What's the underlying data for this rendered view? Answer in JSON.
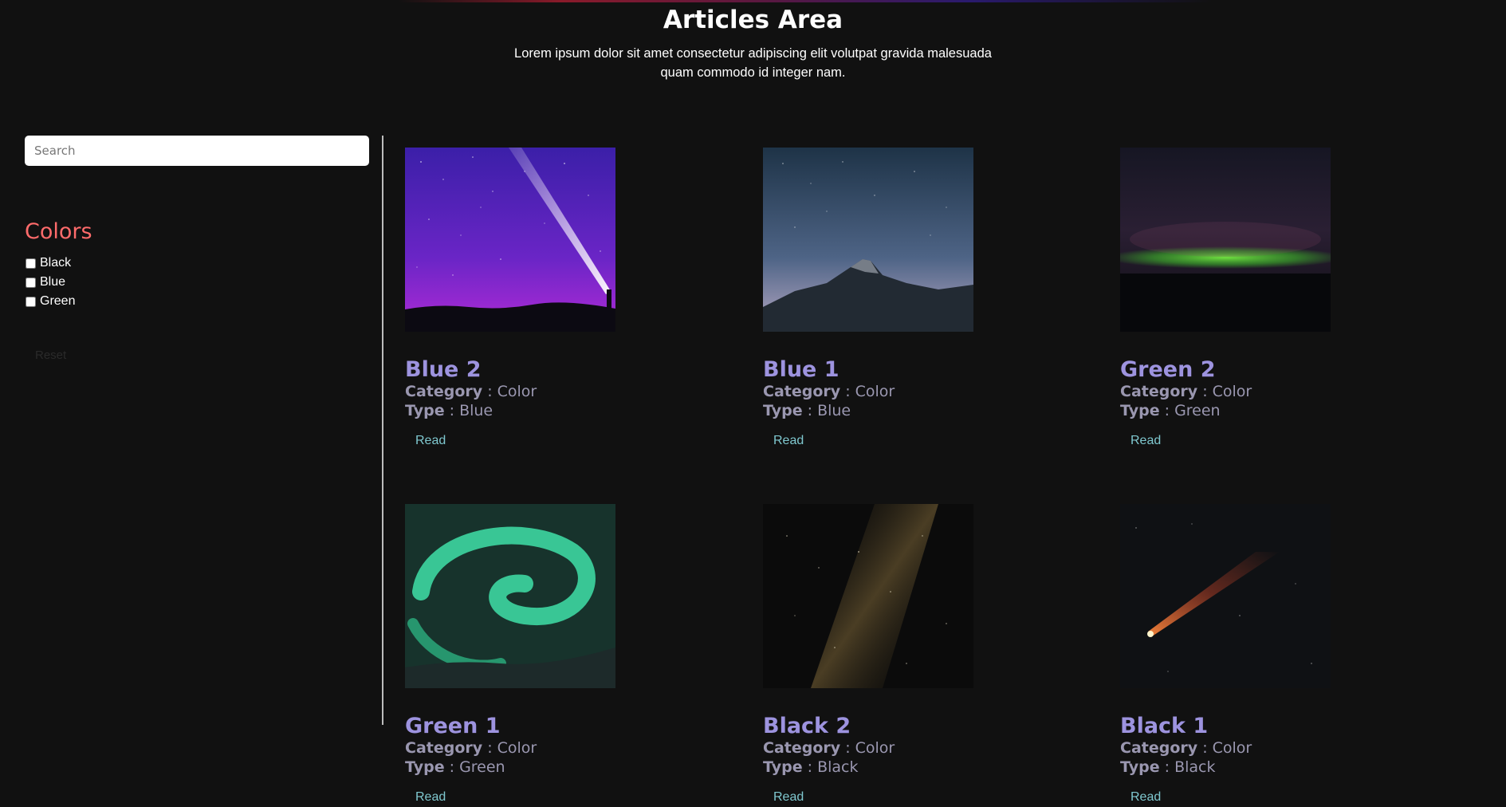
{
  "header": {
    "title": "Articles Area",
    "subtitle": "Lorem ipsum dolor sit amet consectetur adipiscing elit volutpat gravida malesuada quam commodo id integer nam."
  },
  "sidebar": {
    "search_placeholder": "Search",
    "filter_title": "Colors",
    "filters": [
      {
        "label": "Black",
        "checked": false
      },
      {
        "label": "Blue",
        "checked": false
      },
      {
        "label": "Green",
        "checked": false
      }
    ],
    "reset_label": "Reset"
  },
  "meta_labels": {
    "category": "Category",
    "type": "Type",
    "separator": " : "
  },
  "articles": [
    {
      "title": "Blue 2",
      "category": "Color",
      "type": "Blue",
      "read_label": "Read",
      "image": "purple night sky with meteor beam"
    },
    {
      "title": "Blue 1",
      "category": "Color",
      "type": "Blue",
      "read_label": "Read",
      "image": "starry sky over mountain peak"
    },
    {
      "title": "Green 2",
      "category": "Color",
      "type": "Green",
      "read_label": "Read",
      "image": "green aurora band over horizon"
    },
    {
      "title": "Green 1",
      "category": "Color",
      "type": "Green",
      "read_label": "Read",
      "image": "swirling green aurora over hills"
    },
    {
      "title": "Black 2",
      "category": "Color",
      "type": "Black",
      "read_label": "Read",
      "image": "milky way star field"
    },
    {
      "title": "Black 1",
      "category": "Color",
      "type": "Black",
      "read_label": "Read",
      "image": "comet in dark sky"
    }
  ],
  "colors": {
    "background": "#111111",
    "accent_title": "#ff6b6b",
    "card_title": "#9d93df",
    "read_link": "#7fc8cf"
  }
}
